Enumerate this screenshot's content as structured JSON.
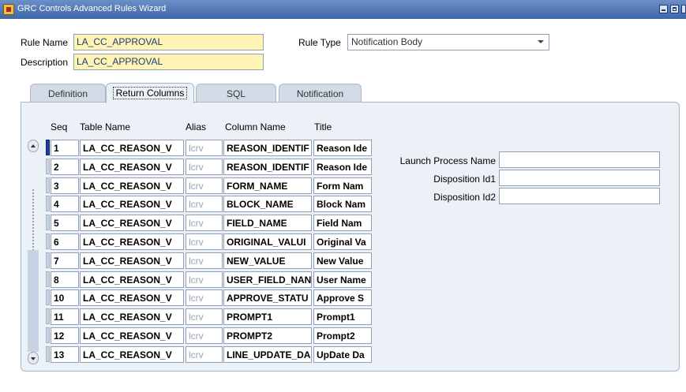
{
  "window": {
    "title": "GRC Controls Advanced Rules Wizard"
  },
  "form": {
    "rule_name_label": "Rule Name",
    "rule_name_value": "LA_CC_APPROVAL",
    "description_label": "Description",
    "description_value": "LA_CC_APPROVAL",
    "rule_type_label": "Rule Type",
    "rule_type_value": "Notification Body"
  },
  "tabs": [
    {
      "label": "Definition"
    },
    {
      "label": "Return Columns",
      "active": true
    },
    {
      "label": "SQL"
    },
    {
      "label": "Notification"
    }
  ],
  "table": {
    "headers": {
      "seq": "Seq",
      "table_name": "Table Name",
      "alias": "Alias",
      "column_name": "Column Name",
      "title": "Title"
    },
    "rows": [
      {
        "seq": "1",
        "table_name": "LA_CC_REASON_V",
        "alias": "lcrv",
        "column_name": "REASON_IDENTIF",
        "title": "Reason Ide"
      },
      {
        "seq": "2",
        "table_name": "LA_CC_REASON_V",
        "alias": "lcrv",
        "column_name": "REASON_IDENTIF",
        "title": "Reason Ide"
      },
      {
        "seq": "3",
        "table_name": "LA_CC_REASON_V",
        "alias": "lcrv",
        "column_name": "FORM_NAME",
        "title": "Form Nam"
      },
      {
        "seq": "4",
        "table_name": "LA_CC_REASON_V",
        "alias": "lcrv",
        "column_name": "BLOCK_NAME",
        "title": "Block Nam"
      },
      {
        "seq": "5",
        "table_name": "LA_CC_REASON_V",
        "alias": "lcrv",
        "column_name": "FIELD_NAME",
        "title": "Field Nam"
      },
      {
        "seq": "6",
        "table_name": "LA_CC_REASON_V",
        "alias": "lcrv",
        "column_name": "ORIGINAL_VALUI",
        "title": "Original Va"
      },
      {
        "seq": "7",
        "table_name": "LA_CC_REASON_V",
        "alias": "lcrv",
        "column_name": "NEW_VALUE",
        "title": "New Value"
      },
      {
        "seq": "8",
        "table_name": "LA_CC_REASON_V",
        "alias": "lcrv",
        "column_name": "USER_FIELD_NAN",
        "title": "User Name"
      },
      {
        "seq": "10",
        "table_name": "LA_CC_REASON_V",
        "alias": "lcrv",
        "column_name": "APPROVE_STATU",
        "title": "Approve S"
      },
      {
        "seq": "11",
        "table_name": "LA_CC_REASON_V",
        "alias": "lcrv",
        "column_name": "PROMPT1",
        "title": "Prompt1"
      },
      {
        "seq": "12",
        "table_name": "LA_CC_REASON_V",
        "alias": "lcrv",
        "column_name": "PROMPT2",
        "title": "Prompt2"
      },
      {
        "seq": "13",
        "table_name": "LA_CC_REASON_V",
        "alias": "lcrv",
        "column_name": "LINE_UPDATE_DA",
        "title": "UpDate Da"
      }
    ]
  },
  "right_fields": [
    {
      "label": "Launch Process Name",
      "value": ""
    },
    {
      "label": "Disposition Id1",
      "value": ""
    },
    {
      "label": "Disposition Id2",
      "value": ""
    }
  ]
}
